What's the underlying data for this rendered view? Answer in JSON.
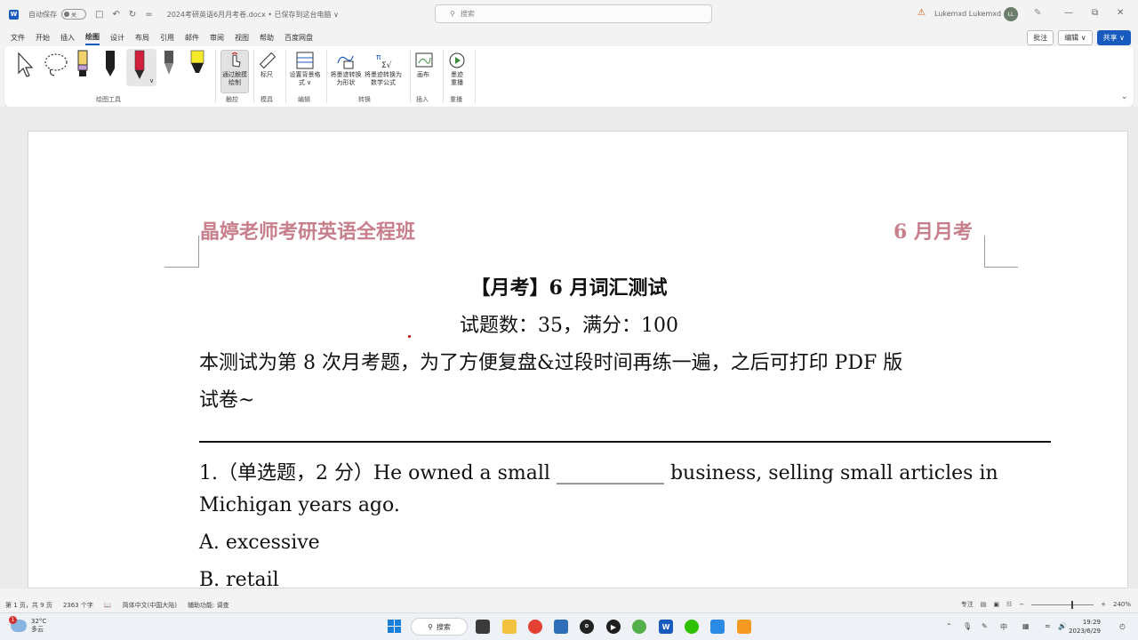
{
  "titlebar": {
    "autosave_label": "自动保存",
    "toggle_state": "关",
    "doc_title": "2024考研英语6月月考卷.docx • 已保存到这台电脑 ∨",
    "search_placeholder": "搜索",
    "user_name": "Lukemxd Lukemxd",
    "avatar_initials": "LL"
  },
  "menu": {
    "tabs": [
      "文件",
      "开始",
      "插入",
      "绘图",
      "设计",
      "布局",
      "引用",
      "邮件",
      "审阅",
      "视图",
      "帮助",
      "百度网盘"
    ],
    "active_tab": "绘图",
    "comment_btn": "批注",
    "edit_btn": "编辑 ∨",
    "share_btn": "共享 ∨"
  },
  "ribbon": {
    "groups": {
      "draw_tools": "绘图工具",
      "touch": "触控",
      "stencils": "模具",
      "edit": "编辑",
      "convert": "转换",
      "insert": "插入",
      "replay": "重播"
    },
    "buttons": {
      "touch_draw": "通过触摸绘制",
      "ruler": "标尺",
      "background": "设置背景格式 ∨",
      "ink_to_shape": "将墨迹转换为形状",
      "ink_to_math": "将墨迹转换为数学公式",
      "canvas": "画布",
      "ink_replay": "墨迹重播"
    }
  },
  "document": {
    "header_left": "晶婷老师考研英语全程班",
    "header_right": "6 月月考",
    "title": "【月考】6 月词汇测试",
    "subtitle": "试题数：35，满分：100",
    "intro_line1": "本测试为第 8 次月考题，为了方便复盘&过段时间再练一遍，之后可打印 PDF 版",
    "intro_line2": "试卷~",
    "question1_line1": "1.（单选题，2 分）He owned a small ___________ business, selling small articles in",
    "question1_line2": "Michigan years ago.",
    "option_a": "A. excessive",
    "option_b": "B. retail"
  },
  "statusbar": {
    "page_info": "第 1 页，共 9 页",
    "word_count": "2363 个字",
    "language": "简体中文(中国大陆)",
    "accessibility": "辅助功能: 调查",
    "focus": "专注",
    "zoom": "240%"
  },
  "taskbar": {
    "temperature": "32°C",
    "weather": "多云",
    "weather_badge": "1",
    "search_label": "搜索",
    "time": "19:29",
    "date": "2023/6/29",
    "ime": "中"
  },
  "colors": {
    "accent": "#185abd",
    "header_pink": "#c77f8c"
  }
}
